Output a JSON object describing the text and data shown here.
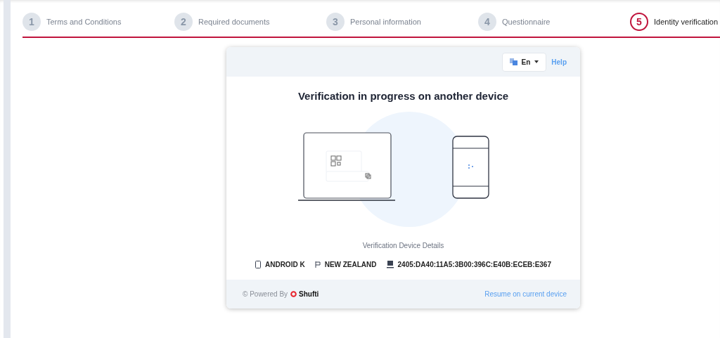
{
  "steps": [
    {
      "number": "1",
      "label": "Terms and Conditions",
      "selected": false
    },
    {
      "number": "2",
      "label": "Required documents",
      "selected": false
    },
    {
      "number": "3",
      "label": "Personal information",
      "selected": false
    },
    {
      "number": "4",
      "label": "Questionnaire",
      "selected": false
    },
    {
      "number": "5",
      "label": "Identity verification",
      "selected": true
    }
  ],
  "card": {
    "language": "En",
    "help": "Help",
    "title": "Verification in progress on another device",
    "details_label": "Verification Device Details",
    "details": [
      {
        "kind": "device",
        "text": "ANDROID K"
      },
      {
        "kind": "country",
        "text": "NEW ZEALAND"
      },
      {
        "kind": "ip",
        "text": "2405:DA40:11A5:3B00:396C:E40B:ECEB:E367"
      }
    ],
    "powered_by": "© Powered By",
    "brand": "Shufti",
    "resume": "Resume on current device"
  }
}
